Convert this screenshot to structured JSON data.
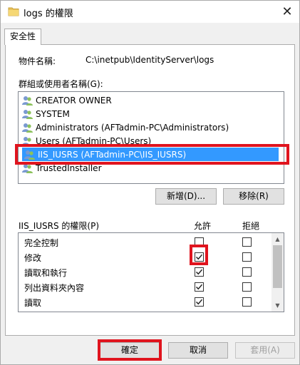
{
  "window": {
    "title": "logs 的權限",
    "close_label": "✕"
  },
  "tabs": [
    {
      "label": "安全性"
    }
  ],
  "object": {
    "label": "物件名稱:",
    "value": "C:\\inetpub\\IdentityServer\\logs"
  },
  "groups": {
    "label": "群組或使用者名稱(G):",
    "items": [
      {
        "label": "CREATOR OWNER"
      },
      {
        "label": "SYSTEM"
      },
      {
        "label": "Administrators (AFTadmin-PC\\Administrators)"
      },
      {
        "label": "Users (AFTadmin-PC\\Users)"
      },
      {
        "label": "IIS_IUSRS (AFTadmin-PC\\IIS_IUSRS)"
      },
      {
        "label": "TrustedInstaller"
      }
    ],
    "selected_index": 4
  },
  "group_buttons": {
    "add_label": "新增(D)...",
    "remove_label": "移除(R)"
  },
  "permissions": {
    "header_label": "IIS_IUSRS 的權限(P)",
    "allow_label": "允許",
    "deny_label": "拒絕",
    "rows": [
      {
        "name": "完全控制",
        "allow": false,
        "deny": false
      },
      {
        "name": "修改",
        "allow": true,
        "deny": false
      },
      {
        "name": "讀取和執行",
        "allow": true,
        "deny": false
      },
      {
        "name": "列出資料夾內容",
        "allow": true,
        "deny": false
      },
      {
        "name": "讀取",
        "allow": true,
        "deny": false
      }
    ]
  },
  "footer": {
    "ok_label": "確定",
    "cancel_label": "取消",
    "apply_label": "套用(A)"
  },
  "colors": {
    "selection": "#3399ff",
    "highlight": "#e0141e"
  }
}
